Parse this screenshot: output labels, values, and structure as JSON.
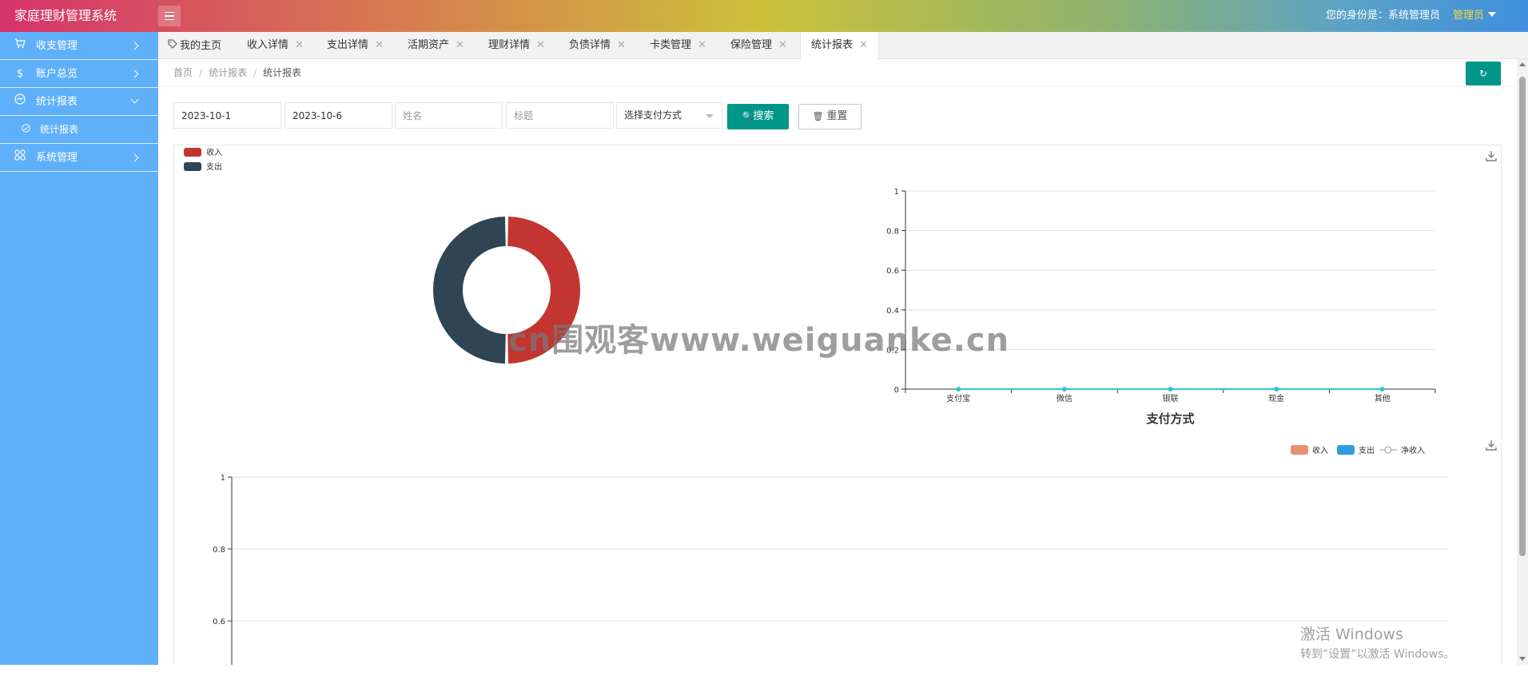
{
  "header": {
    "title": "家庭理财管理系统",
    "identity": "您的身份是：系统管理员",
    "user": "管理员"
  },
  "sidebar": {
    "items": [
      {
        "label": "收支管理",
        "icon": "cart-icon"
      },
      {
        "label": "账户总览",
        "icon": "dollar-icon"
      },
      {
        "label": "统计报表",
        "icon": "chart-circle-icon"
      },
      {
        "label": "系统管理",
        "icon": "grid-icon"
      }
    ],
    "sub": {
      "label": "统计报表",
      "icon": "circle-check-icon"
    }
  },
  "tabs": [
    {
      "label": "我的主页"
    },
    {
      "label": "收入详情"
    },
    {
      "label": "支出详情"
    },
    {
      "label": "活期资产"
    },
    {
      "label": "理财详情"
    },
    {
      "label": "负债详情"
    },
    {
      "label": "卡类管理"
    },
    {
      "label": "保险管理"
    },
    {
      "label": "统计报表"
    }
  ],
  "close_glyph": "✕",
  "breadcrumb": {
    "home": "首页",
    "parent": "统计报表",
    "current": "统计报表",
    "sep": "/"
  },
  "refresh_glyph": "↻",
  "filters": {
    "start_date": "2023-10-1",
    "end_date": "2023-10-6",
    "name_placeholder": "姓名",
    "title_placeholder": "标题",
    "payment_select": "选择支付方式",
    "search_label": "搜索",
    "reset_label": "重置",
    "search_glyph": "🔍",
    "reset_glyph": "🗑"
  },
  "colors": {
    "primary": "#009688",
    "sidebar": "#5fb0fb",
    "income": "#c23531",
    "expense": "#2f4554",
    "line": "#2ec7c9",
    "bar_income": "#e8916e",
    "bar_expense": "#2f9ee0"
  },
  "chart_data": [
    {
      "type": "pie",
      "legend": [
        "收入",
        "支出"
      ],
      "labels": [
        "收入",
        "支出"
      ],
      "values": [
        1,
        1
      ],
      "donut": true,
      "legend_position": "top-left"
    },
    {
      "type": "line",
      "categories": [
        "支付宝",
        "微信",
        "银联",
        "现金",
        "其他"
      ],
      "values": [
        0,
        0,
        0,
        0,
        0
      ],
      "xlabel": "支付方式",
      "ylim": [
        0,
        1
      ],
      "yticks": [
        "0",
        "0.2",
        "0.4",
        "0.6",
        "0.8",
        "1"
      ],
      "grid": true
    },
    {
      "type": "bar",
      "legend": [
        "收入",
        "支出",
        "净收入"
      ],
      "legend_position": "top-right",
      "ylim": [
        0,
        1
      ],
      "yticks": [
        "1",
        "0.8",
        "0.6"
      ],
      "grid": true,
      "series": [
        {
          "name": "收入",
          "values": []
        },
        {
          "name": "支出",
          "values": []
        },
        {
          "name": "净收入",
          "values": []
        }
      ]
    }
  ],
  "watermark": "cn围观客www.weiguanke.cn",
  "windows": {
    "line1": "激活 Windows",
    "line2": "转到“设置”以激活 Windows。"
  }
}
